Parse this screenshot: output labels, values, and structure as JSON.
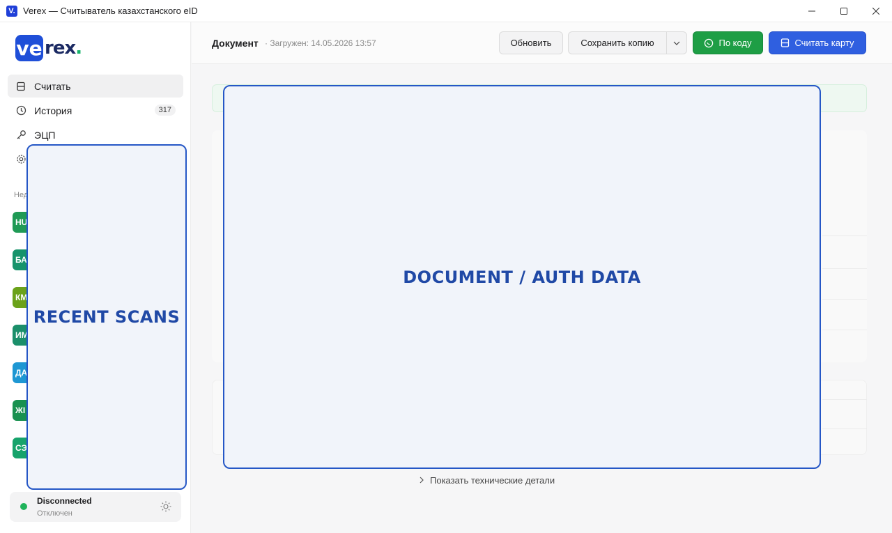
{
  "window": {
    "title": "Verex — Считыватель казахстанского eID",
    "app_icon_letter": "V."
  },
  "logo": {
    "badge": "ve",
    "text": "rex",
    "dot": "."
  },
  "sidebar": {
    "items": [
      {
        "label": "Считать",
        "icon": "card-reader-icon",
        "active": true
      },
      {
        "label": "История",
        "icon": "clock-icon",
        "badge": "317"
      },
      {
        "label": "ЭЦП",
        "icon": "key-icon"
      },
      {
        "label": "",
        "icon": "gear-icon"
      }
    ],
    "section_label": "Нед",
    "recent_chips": [
      {
        "text": "HU",
        "color": "#1f9a55"
      },
      {
        "text": "БА",
        "color": "#17936b"
      },
      {
        "text": "КМ",
        "color": "#6ba21a"
      },
      {
        "text": "ИМ",
        "color": "#1b8f6a"
      },
      {
        "text": "ДА",
        "color": "#1e97d3"
      },
      {
        "text": "ЖІ",
        "color": "#1a9150"
      },
      {
        "text": "СЭ",
        "color": "#16a36b"
      }
    ],
    "recent_overlay_label": "RECENT SCANS",
    "status": {
      "main": "Disconnected",
      "sub": "Отключен",
      "dot_color": "#1fb35a"
    }
  },
  "header": {
    "title": "Документ",
    "loaded": "· Загружен: 14.05.2026 13:57",
    "refresh_label": "Обновить",
    "save_copy_label": "Сохранить копию",
    "by_code_label": "По коду",
    "read_card_label": "Считать карту"
  },
  "main": {
    "overlay_label": "DOCUMENT / AUTH DATA",
    "tech_details_label": "Показать технические детали"
  }
}
